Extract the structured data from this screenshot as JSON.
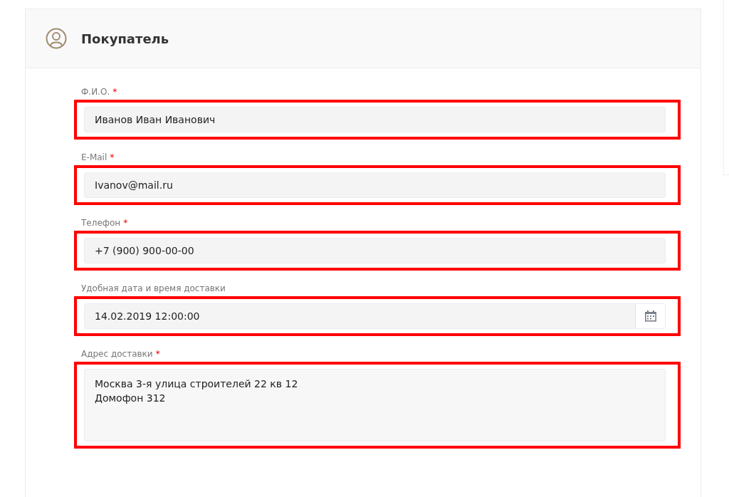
{
  "card": {
    "title": "Покупатель"
  },
  "fields": [
    {
      "kind": "text",
      "label": "Ф.И.О.",
      "required_mark": "*",
      "value": "Иванов Иван Иванович",
      "highlighted": true
    },
    {
      "kind": "text",
      "label": "E-Mail",
      "required_mark": "*",
      "value": "Ivanov@mail.ru",
      "highlighted": true
    },
    {
      "kind": "text",
      "label": "Телефон",
      "required_mark": "*",
      "value": "+7 (900) 900-00-00",
      "highlighted": true
    },
    {
      "kind": "date",
      "label": "Удобная дата и время доставки",
      "value": "14.02.2019 12:00:00",
      "highlighted": true
    },
    {
      "kind": "textarea",
      "label": "Адрес доставки",
      "required_mark": "*",
      "value": "Москва 3-я улица строителей 22 кв 12\nДомофон 312",
      "highlighted": true
    }
  ]
}
